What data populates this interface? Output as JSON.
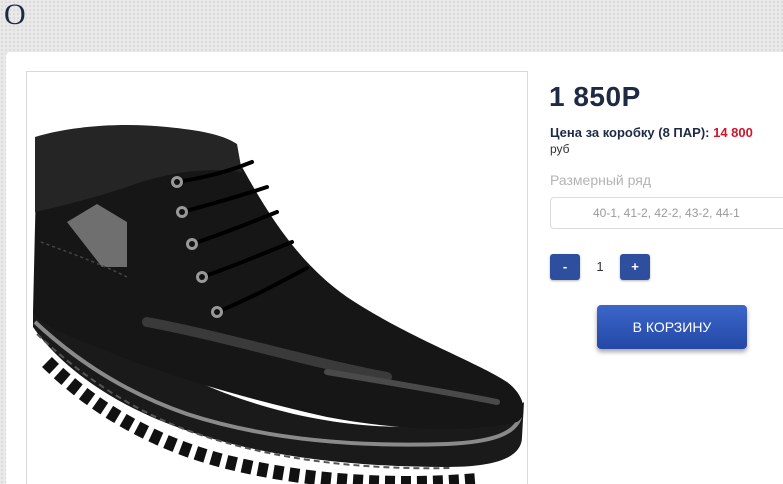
{
  "header": {
    "title_fragment": "O"
  },
  "product": {
    "image_icon": "boot-photo",
    "price": "1 850Р",
    "box_price_label": "Цена за коробку (8 ПАР): ",
    "box_price_value": "14 800",
    "box_price_currency": "руб",
    "size_label": "Размерный ряд",
    "size_value": "40-1, 41-2, 42-2, 43-2, 44-1",
    "quantity": "1",
    "minus_label": "-",
    "plus_label": "+",
    "cart_label": "В КОРЗИНУ"
  },
  "colors": {
    "accent": "#2e4f9e",
    "price_text": "#1e2a44",
    "box_price_value": "#d2142d"
  }
}
